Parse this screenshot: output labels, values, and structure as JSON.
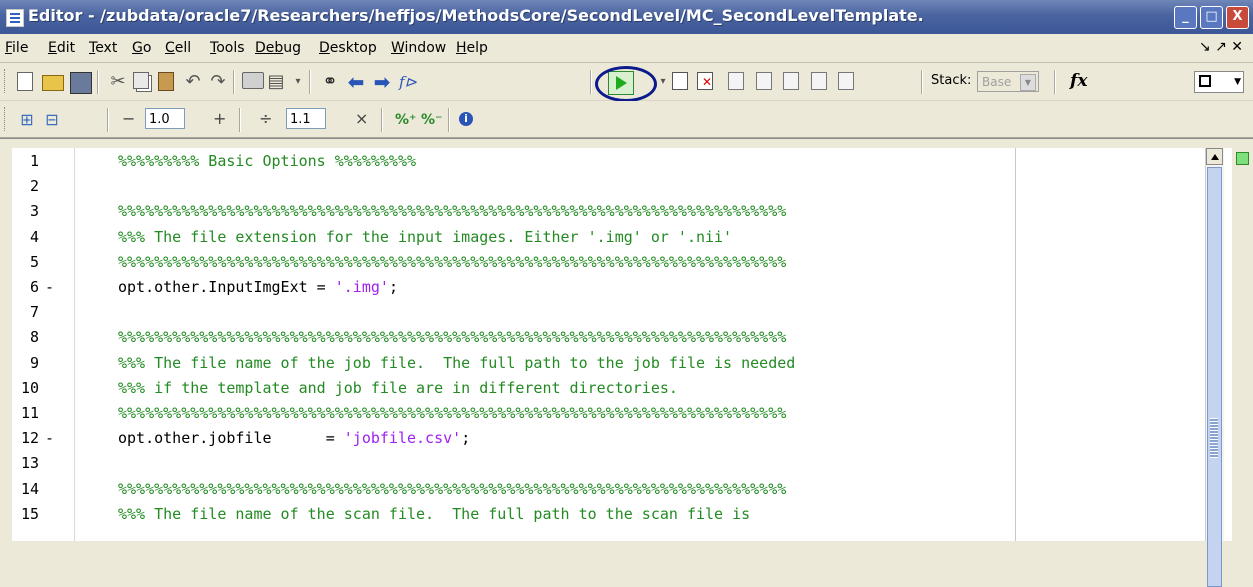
{
  "window": {
    "title": "Editor - /zubdata/oracle7/Researchers/heffjos/MethodsCore/SecondLevel/MC_SecondLevelTemplate.",
    "buttons": [
      "_",
      "□",
      "X"
    ]
  },
  "menubar": {
    "items": [
      {
        "label": "File",
        "key": "F",
        "rest": "ile"
      },
      {
        "label": "Edit",
        "key": "E",
        "rest": "dit"
      },
      {
        "label": "Text",
        "key": "T",
        "rest": "ext"
      },
      {
        "label": "Go",
        "key": "G",
        "rest": "o"
      },
      {
        "label": "Cell",
        "key": "C",
        "rest": "ell"
      },
      {
        "label": "Tools",
        "key": "T",
        "rest": "ools"
      },
      {
        "label": "Debug",
        "key": "Deb",
        "rest": "ug"
      },
      {
        "label": "Desktop",
        "key": "D",
        "rest": "esktop"
      },
      {
        "label": "Window",
        "key": "W",
        "rest": "indow"
      },
      {
        "label": "Help",
        "key": "H",
        "rest": "elp"
      }
    ],
    "right_controls": "↘  ↗ ✕"
  },
  "toolbar": {
    "stack_label": "Stack:",
    "stack_value": "Base",
    "fx_label": "fx"
  },
  "cell_toolbar": {
    "minus": "−",
    "plus": "+",
    "divide": "÷",
    "times": "×",
    "decrement_value": "1.0",
    "divide_value": "1.1"
  },
  "editor": {
    "lines": [
      {
        "n": "1",
        "mark": "",
        "parts": [
          {
            "t": "%%%%%%%%% Basic Options %%%%%%%%%",
            "c": "comment"
          }
        ]
      },
      {
        "n": "2",
        "mark": "",
        "parts": []
      },
      {
        "n": "3",
        "mark": "",
        "parts": [
          {
            "t": "%%%%%%%%%%%%%%%%%%%%%%%%%%%%%%%%%%%%%%%%%%%%%%%%%%%%%%%%%%%%%%%%%%%%%%%%%%",
            "c": "comment"
          }
        ]
      },
      {
        "n": "4",
        "mark": "",
        "parts": [
          {
            "t": "%%% The file extension for the input images. Either '.img' or '.nii'",
            "c": "comment"
          }
        ]
      },
      {
        "n": "5",
        "mark": "",
        "parts": [
          {
            "t": "%%%%%%%%%%%%%%%%%%%%%%%%%%%%%%%%%%%%%%%%%%%%%%%%%%%%%%%%%%%%%%%%%%%%%%%%%%",
            "c": "comment"
          }
        ]
      },
      {
        "n": "6",
        "mark": "-",
        "parts": [
          {
            "t": "opt.other.InputImgExt = ",
            "c": "normal"
          },
          {
            "t": "'.img'",
            "c": "str"
          },
          {
            "t": ";",
            "c": "normal"
          }
        ]
      },
      {
        "n": "7",
        "mark": "",
        "parts": []
      },
      {
        "n": "8",
        "mark": "",
        "parts": [
          {
            "t": "%%%%%%%%%%%%%%%%%%%%%%%%%%%%%%%%%%%%%%%%%%%%%%%%%%%%%%%%%%%%%%%%%%%%%%%%%%",
            "c": "comment"
          }
        ]
      },
      {
        "n": "9",
        "mark": "",
        "parts": [
          {
            "t": "%%% The file name of the job file.  The full path to the job file is needed",
            "c": "comment"
          }
        ]
      },
      {
        "n": "10",
        "mark": "",
        "parts": [
          {
            "t": "%%% if the template and job file are in different directories.",
            "c": "comment"
          }
        ]
      },
      {
        "n": "11",
        "mark": "",
        "parts": [
          {
            "t": "%%%%%%%%%%%%%%%%%%%%%%%%%%%%%%%%%%%%%%%%%%%%%%%%%%%%%%%%%%%%%%%%%%%%%%%%%%",
            "c": "comment"
          }
        ]
      },
      {
        "n": "12",
        "mark": "-",
        "parts": [
          {
            "t": "opt.other.jobfile      = ",
            "c": "normal"
          },
          {
            "t": "'jobfile.csv'",
            "c": "str"
          },
          {
            "t": ";",
            "c": "normal"
          }
        ]
      },
      {
        "n": "13",
        "mark": "",
        "parts": []
      },
      {
        "n": "14",
        "mark": "",
        "parts": [
          {
            "t": "%%%%%%%%%%%%%%%%%%%%%%%%%%%%%%%%%%%%%%%%%%%%%%%%%%%%%%%%%%%%%%%%%%%%%%%%%%",
            "c": "comment"
          }
        ]
      },
      {
        "n": "15",
        "mark": "",
        "parts": [
          {
            "t": "%%% The file name of the scan file.  The full path to the scan file is",
            "c": "comment"
          }
        ]
      }
    ]
  },
  "colors": {
    "comment": "#228b22",
    "string": "#a020f0",
    "titlebar": "#4a64a0",
    "run_highlight": "#0c1a8c"
  },
  "icons": [
    "new-file-icon",
    "open-folder-icon",
    "save-icon",
    "cut-icon",
    "copy-icon",
    "paste-icon",
    "undo-icon",
    "redo-icon",
    "print-icon",
    "find-icon",
    "back-icon",
    "forward-icon",
    "function-icon",
    "run-icon",
    "breakpoint-icon",
    "info-icon"
  ]
}
